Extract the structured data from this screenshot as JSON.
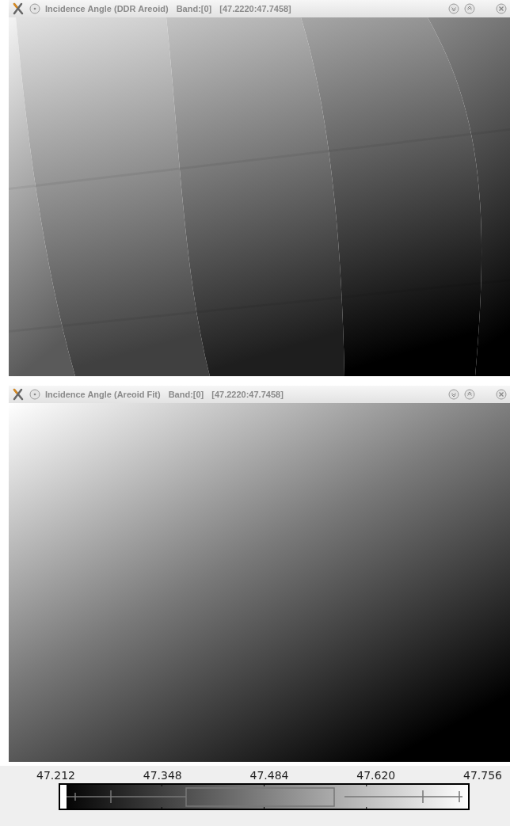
{
  "windows": [
    {
      "kind": "banded",
      "title": "Incidence Angle (DDR Areoid)",
      "band": "Band:[0]",
      "range": "[47.2220:47.7458]"
    },
    {
      "kind": "gradient",
      "title": "Incidence Angle (Areoid Fit)",
      "band": "Band:[0]",
      "range": "[47.2220:47.7458]"
    }
  ],
  "colorbar": {
    "ticks": [
      "47.212",
      "47.348",
      "47.484",
      "47.620",
      "47.756"
    ]
  }
}
